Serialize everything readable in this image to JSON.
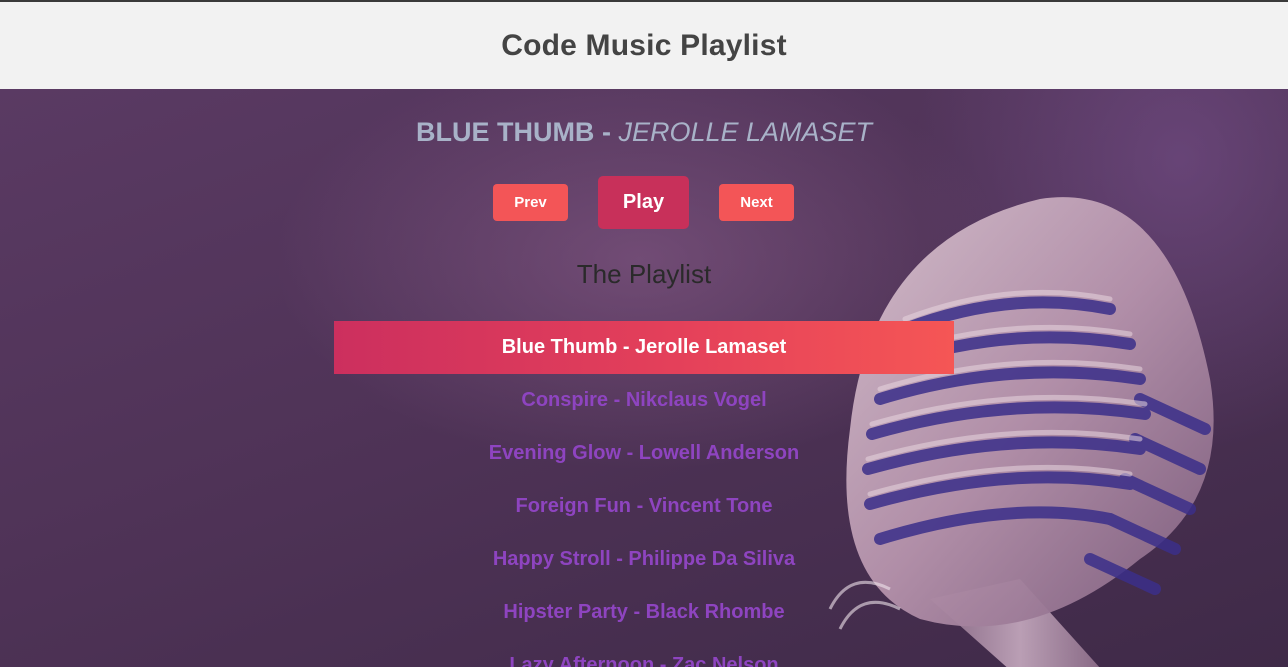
{
  "header": {
    "title": "Code Music Playlist"
  },
  "now_playing": {
    "title": "Blue Thumb",
    "separator": " - ",
    "artist": "Jerolle Lamaset"
  },
  "controls": {
    "prev_label": "Prev",
    "play_label": "Play",
    "next_label": "Next"
  },
  "playlist": {
    "heading": "The Playlist",
    "active_index": 0,
    "tracks": [
      "Blue Thumb - Jerolle Lamaset",
      "Conspire - Nikclaus Vogel",
      "Evening Glow - Lowell Anderson",
      "Foreign Fun - Vincent Tone",
      "Happy Stroll - Philippe Da Siliva",
      "Hipster Party - Black Rhombe",
      "Lazy Afternoon - Zac Nelson"
    ]
  },
  "colors": {
    "accent": "#f35557",
    "play_button": "#c8305a",
    "track_text": "#8e44c0",
    "now_playing_text": "#a8b2c8"
  },
  "icons": {
    "background_image": "microphone-image"
  }
}
